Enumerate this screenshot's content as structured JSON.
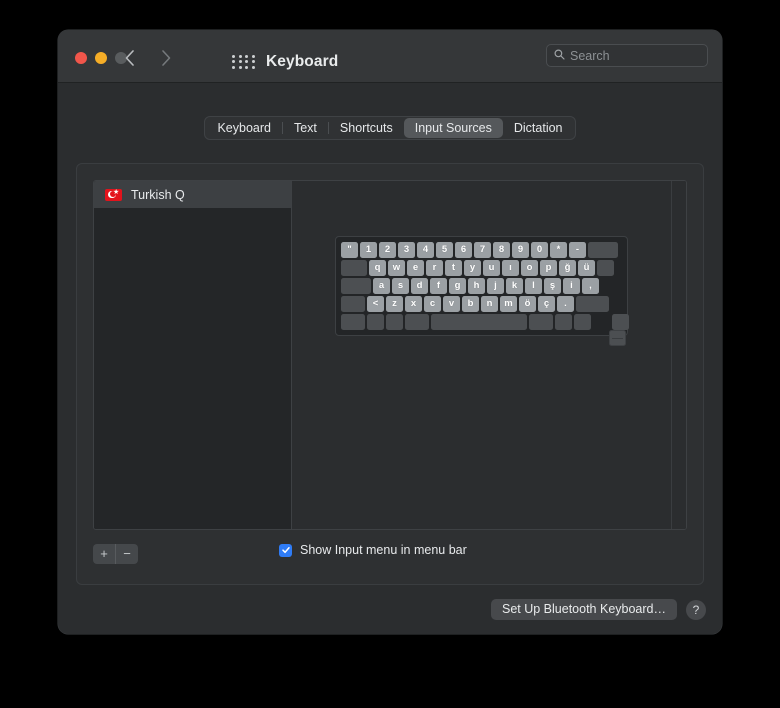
{
  "window": {
    "title": "Keyboard",
    "traffic_lights": [
      "close-red",
      "minimize-yellow",
      "zoom-gray-disabled"
    ],
    "back_icon": "chevron-left-icon",
    "forward_icon": "chevron-right-icon",
    "grid_icon": "show-all-grid-icon"
  },
  "search": {
    "placeholder": "Search",
    "value": "",
    "icon": "search-icon"
  },
  "tabs": [
    {
      "label": "Keyboard",
      "selected": false
    },
    {
      "label": "Text",
      "selected": false
    },
    {
      "label": "Shortcuts",
      "selected": false
    },
    {
      "label": "Input Sources",
      "selected": true
    },
    {
      "label": "Dictation",
      "selected": false
    }
  ],
  "input_sources": {
    "items": [
      {
        "label": "Turkish Q",
        "flag": "turkey-flag-icon",
        "selected": true
      }
    ],
    "add_button_label": "+",
    "remove_button_label": "−"
  },
  "keyboard_preview": {
    "rows": [
      [
        {
          "label": "\"",
          "width": "w17",
          "blank": false
        },
        {
          "label": "1",
          "width": "w17",
          "blank": false
        },
        {
          "label": "2",
          "width": "w17",
          "blank": false
        },
        {
          "label": "3",
          "width": "w17",
          "blank": false
        },
        {
          "label": "4",
          "width": "w17",
          "blank": false
        },
        {
          "label": "5",
          "width": "w17",
          "blank": false
        },
        {
          "label": "6",
          "width": "w17",
          "blank": false
        },
        {
          "label": "7",
          "width": "w17",
          "blank": false
        },
        {
          "label": "8",
          "width": "w17",
          "blank": false
        },
        {
          "label": "9",
          "width": "w17",
          "blank": false
        },
        {
          "label": "0",
          "width": "w17",
          "blank": false
        },
        {
          "label": "*",
          "width": "w17",
          "blank": false
        },
        {
          "label": "-",
          "width": "w17",
          "blank": false
        },
        {
          "label": "",
          "width": "w30",
          "blank": true
        }
      ],
      [
        {
          "label": "",
          "width": "w26",
          "blank": true
        },
        {
          "label": "q",
          "width": "w17",
          "blank": false
        },
        {
          "label": "w",
          "width": "w17",
          "blank": false
        },
        {
          "label": "e",
          "width": "w17",
          "blank": false
        },
        {
          "label": "r",
          "width": "w17",
          "blank": false
        },
        {
          "label": "t",
          "width": "w17",
          "blank": false
        },
        {
          "label": "y",
          "width": "w17",
          "blank": false
        },
        {
          "label": "u",
          "width": "w17",
          "blank": false
        },
        {
          "label": "ı",
          "width": "w17",
          "blank": false
        },
        {
          "label": "o",
          "width": "w17",
          "blank": false
        },
        {
          "label": "p",
          "width": "w17",
          "blank": false
        },
        {
          "label": "ğ",
          "width": "w17",
          "blank": false
        },
        {
          "label": "ü",
          "width": "w17",
          "blank": false
        },
        {
          "label": "",
          "width": "w21",
          "blank": true
        }
      ],
      [
        {
          "label": "",
          "width": "w30",
          "blank": true
        },
        {
          "label": "a",
          "width": "w17",
          "blank": false
        },
        {
          "label": "s",
          "width": "w17",
          "blank": false
        },
        {
          "label": "d",
          "width": "w17",
          "blank": false
        },
        {
          "label": "f",
          "width": "w17",
          "blank": false
        },
        {
          "label": "g",
          "width": "w17",
          "blank": false
        },
        {
          "label": "h",
          "width": "w17",
          "blank": false
        },
        {
          "label": "j",
          "width": "w17",
          "blank": false
        },
        {
          "label": "k",
          "width": "w17",
          "blank": false
        },
        {
          "label": "l",
          "width": "w17",
          "blank": false
        },
        {
          "label": "ş",
          "width": "w17",
          "blank": false
        },
        {
          "label": "i",
          "width": "w17",
          "blank": false
        },
        {
          "label": ",",
          "width": "w17",
          "blank": false
        }
      ],
      [
        {
          "label": "",
          "width": "w24",
          "blank": true
        },
        {
          "label": "<",
          "width": "w17",
          "blank": false
        },
        {
          "label": "z",
          "width": "w17",
          "blank": false
        },
        {
          "label": "x",
          "width": "w17",
          "blank": false
        },
        {
          "label": "c",
          "width": "w17",
          "blank": false
        },
        {
          "label": "v",
          "width": "w17",
          "blank": false
        },
        {
          "label": "b",
          "width": "w17",
          "blank": false
        },
        {
          "label": "n",
          "width": "w17",
          "blank": false
        },
        {
          "label": "m",
          "width": "w17",
          "blank": false
        },
        {
          "label": "ö",
          "width": "w17",
          "blank": false
        },
        {
          "label": "ç",
          "width": "w17",
          "blank": false
        },
        {
          "label": ".",
          "width": "w17",
          "blank": false
        },
        {
          "label": "",
          "width": "w33",
          "blank": true
        }
      ],
      [
        {
          "label": "",
          "width": "w24",
          "blank": true
        },
        {
          "label": "",
          "width": "w17",
          "blank": true
        },
        {
          "label": "",
          "width": "w17",
          "blank": true
        },
        {
          "label": "",
          "width": "w24",
          "blank": true
        },
        {
          "label": "",
          "width": "w96",
          "blank": true
        },
        {
          "label": "",
          "width": "w24",
          "blank": true
        },
        {
          "label": "",
          "width": "w17",
          "blank": true
        },
        {
          "label": "",
          "width": "w17",
          "blank": true
        },
        {
          "label": "",
          "width": "w17",
          "blank": true,
          "split": true
        },
        {
          "label": "",
          "width": "w17",
          "blank": true
        }
      ]
    ]
  },
  "show_input_menu": {
    "label": "Show Input menu in menu bar",
    "checked": true,
    "check_glyph": "✓"
  },
  "footer": {
    "bluetooth_button_label": "Set Up Bluetooth Keyboard…",
    "help_button_label": "?"
  },
  "colors": {
    "accent_blue": "#2f7cf6",
    "flag_red": "#e3131c",
    "window_body": "#2b2d2f",
    "titlebar": "#353739"
  }
}
